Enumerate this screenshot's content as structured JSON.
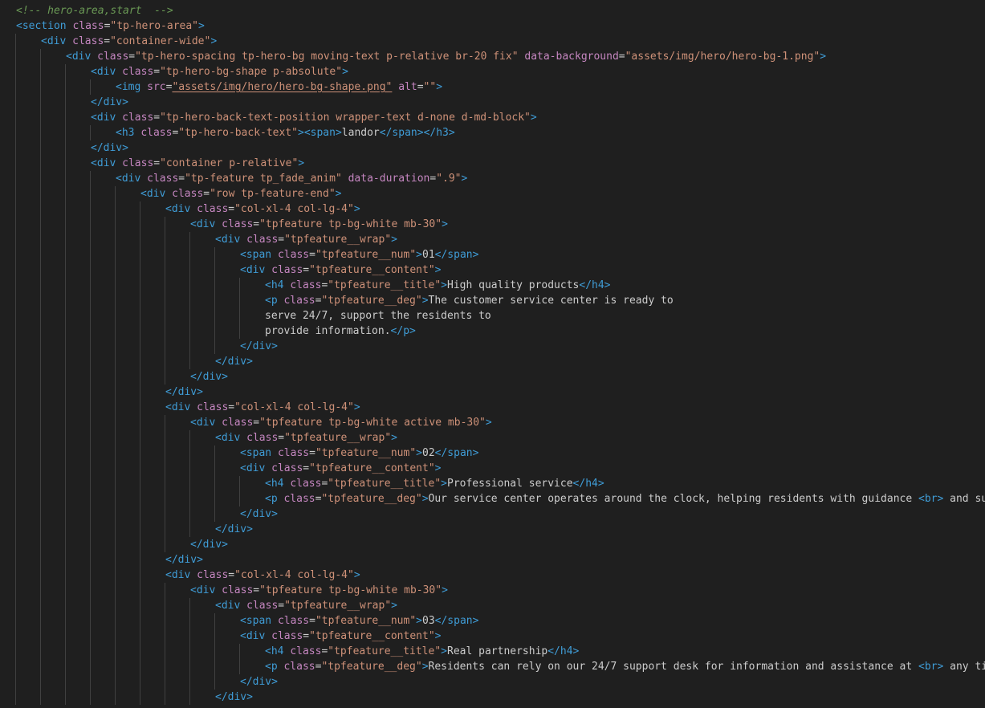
{
  "editor": {
    "language": "html",
    "lines": [
      {
        "indent": 0,
        "tokens": [
          [
            "c",
            "<!-- hero-area,start  -->"
          ]
        ]
      },
      {
        "indent": 0,
        "tokens": [
          [
            "t",
            "<section"
          ],
          [
            "x",
            " "
          ],
          [
            "a",
            "class"
          ],
          [
            "x",
            "="
          ],
          [
            "s",
            "\"tp-hero-area\""
          ],
          [
            "t",
            ">"
          ]
        ]
      },
      {
        "indent": 1,
        "tokens": [
          [
            "t",
            "<div"
          ],
          [
            "x",
            " "
          ],
          [
            "a",
            "class"
          ],
          [
            "x",
            "="
          ],
          [
            "s",
            "\"container-wide\""
          ],
          [
            "t",
            ">"
          ]
        ]
      },
      {
        "indent": 2,
        "tokens": [
          [
            "t",
            "<div"
          ],
          [
            "x",
            " "
          ],
          [
            "a",
            "class"
          ],
          [
            "x",
            "="
          ],
          [
            "s",
            "\"tp-hero-spacing tp-hero-bg moving-text p-relative br-20 fix\""
          ],
          [
            "x",
            " "
          ],
          [
            "a",
            "data-background"
          ],
          [
            "x",
            "="
          ],
          [
            "s",
            "\"assets/img/hero/hero-bg-1.png\""
          ],
          [
            "t",
            ">"
          ]
        ]
      },
      {
        "indent": 3,
        "tokens": [
          [
            "t",
            "<div"
          ],
          [
            "x",
            " "
          ],
          [
            "a",
            "class"
          ],
          [
            "x",
            "="
          ],
          [
            "s",
            "\"tp-hero-bg-shape p-absolute\""
          ],
          [
            "t",
            ">"
          ]
        ]
      },
      {
        "indent": 4,
        "tokens": [
          [
            "t",
            "<img"
          ],
          [
            "x",
            " "
          ],
          [
            "a",
            "src"
          ],
          [
            "x",
            "="
          ],
          [
            "su",
            "\"assets/img/hero/hero-bg-shape.png\""
          ],
          [
            "x",
            " "
          ],
          [
            "a",
            "alt"
          ],
          [
            "x",
            "="
          ],
          [
            "s",
            "\"\""
          ],
          [
            "t",
            ">"
          ]
        ]
      },
      {
        "indent": 3,
        "tokens": [
          [
            "t",
            "</div>"
          ]
        ]
      },
      {
        "indent": 3,
        "tokens": [
          [
            "t",
            "<div"
          ],
          [
            "x",
            " "
          ],
          [
            "a",
            "class"
          ],
          [
            "x",
            "="
          ],
          [
            "s",
            "\"tp-hero-back-text-position wrapper-text d-none d-md-block\""
          ],
          [
            "t",
            ">"
          ]
        ]
      },
      {
        "indent": 4,
        "tokens": [
          [
            "t",
            "<h3"
          ],
          [
            "x",
            " "
          ],
          [
            "a",
            "class"
          ],
          [
            "x",
            "="
          ],
          [
            "s",
            "\"tp-hero-back-text\""
          ],
          [
            "t",
            ">"
          ],
          [
            "t",
            "<span>"
          ],
          [
            "x",
            "landor"
          ],
          [
            "t",
            "</span>"
          ],
          [
            "t",
            "</h3>"
          ]
        ]
      },
      {
        "indent": 3,
        "tokens": [
          [
            "t",
            "</div>"
          ]
        ]
      },
      {
        "indent": 3,
        "tokens": [
          [
            "t",
            "<div"
          ],
          [
            "x",
            " "
          ],
          [
            "a",
            "class"
          ],
          [
            "x",
            "="
          ],
          [
            "s",
            "\"container p-relative\""
          ],
          [
            "t",
            ">"
          ]
        ]
      },
      {
        "indent": 4,
        "tokens": [
          [
            "t",
            "<div"
          ],
          [
            "x",
            " "
          ],
          [
            "a",
            "class"
          ],
          [
            "x",
            "="
          ],
          [
            "s",
            "\"tp-feature tp_fade_anim\""
          ],
          [
            "x",
            " "
          ],
          [
            "a",
            "data-duration"
          ],
          [
            "x",
            "="
          ],
          [
            "s",
            "\".9\""
          ],
          [
            "t",
            ">"
          ]
        ]
      },
      {
        "indent": 5,
        "tokens": [
          [
            "t",
            "<div"
          ],
          [
            "x",
            " "
          ],
          [
            "a",
            "class"
          ],
          [
            "x",
            "="
          ],
          [
            "s",
            "\"row tp-feature-end\""
          ],
          [
            "t",
            ">"
          ]
        ]
      },
      {
        "indent": 6,
        "tokens": [
          [
            "t",
            "<div"
          ],
          [
            "x",
            " "
          ],
          [
            "a",
            "class"
          ],
          [
            "x",
            "="
          ],
          [
            "s",
            "\"col-xl-4 col-lg-4\""
          ],
          [
            "t",
            ">"
          ]
        ]
      },
      {
        "indent": 7,
        "tokens": [
          [
            "t",
            "<div"
          ],
          [
            "x",
            " "
          ],
          [
            "a",
            "class"
          ],
          [
            "x",
            "="
          ],
          [
            "s",
            "\"tpfeature tp-bg-white mb-30\""
          ],
          [
            "t",
            ">"
          ]
        ]
      },
      {
        "indent": 8,
        "tokens": [
          [
            "t",
            "<div"
          ],
          [
            "x",
            " "
          ],
          [
            "a",
            "class"
          ],
          [
            "x",
            "="
          ],
          [
            "s",
            "\"tpfeature__wrap\""
          ],
          [
            "t",
            ">"
          ]
        ]
      },
      {
        "indent": 9,
        "tokens": [
          [
            "t",
            "<span"
          ],
          [
            "x",
            " "
          ],
          [
            "a",
            "class"
          ],
          [
            "x",
            "="
          ],
          [
            "s",
            "\"tpfeature__num\""
          ],
          [
            "t",
            ">"
          ],
          [
            "x",
            "01"
          ],
          [
            "t",
            "</span>"
          ]
        ]
      },
      {
        "indent": 9,
        "tokens": [
          [
            "t",
            "<div"
          ],
          [
            "x",
            " "
          ],
          [
            "a",
            "class"
          ],
          [
            "x",
            "="
          ],
          [
            "s",
            "\"tpfeature__content\""
          ],
          [
            "t",
            ">"
          ]
        ]
      },
      {
        "indent": 10,
        "tokens": [
          [
            "t",
            "<h4"
          ],
          [
            "x",
            " "
          ],
          [
            "a",
            "class"
          ],
          [
            "x",
            "="
          ],
          [
            "s",
            "\"tpfeature__title\""
          ],
          [
            "t",
            ">"
          ],
          [
            "x",
            "High quality products"
          ],
          [
            "t",
            "</h4>"
          ]
        ]
      },
      {
        "indent": 10,
        "tokens": [
          [
            "t",
            "<p"
          ],
          [
            "x",
            " "
          ],
          [
            "a",
            "class"
          ],
          [
            "x",
            "="
          ],
          [
            "s",
            "\"tpfeature__deg\""
          ],
          [
            "t",
            ">"
          ],
          [
            "x",
            "The customer service center is ready to"
          ]
        ]
      },
      {
        "indent": 10,
        "tokens": [
          [
            "x",
            "serve 24/7, support the residents to"
          ]
        ]
      },
      {
        "indent": 10,
        "tokens": [
          [
            "x",
            "provide information."
          ],
          [
            "t",
            "</p>"
          ]
        ]
      },
      {
        "indent": 9,
        "tokens": [
          [
            "t",
            "</div>"
          ]
        ]
      },
      {
        "indent": 8,
        "tokens": [
          [
            "t",
            "</div>"
          ]
        ]
      },
      {
        "indent": 7,
        "tokens": [
          [
            "t",
            "</div>"
          ]
        ]
      },
      {
        "indent": 6,
        "tokens": [
          [
            "t",
            "</div>"
          ]
        ]
      },
      {
        "indent": 6,
        "tokens": [
          [
            "t",
            "<div"
          ],
          [
            "x",
            " "
          ],
          [
            "a",
            "class"
          ],
          [
            "x",
            "="
          ],
          [
            "s",
            "\"col-xl-4 col-lg-4\""
          ],
          [
            "t",
            ">"
          ]
        ]
      },
      {
        "indent": 7,
        "tokens": [
          [
            "t",
            "<div"
          ],
          [
            "x",
            " "
          ],
          [
            "a",
            "class"
          ],
          [
            "x",
            "="
          ],
          [
            "s",
            "\"tpfeature tp-bg-white active mb-30\""
          ],
          [
            "t",
            ">"
          ]
        ]
      },
      {
        "indent": 8,
        "tokens": [
          [
            "t",
            "<div"
          ],
          [
            "x",
            " "
          ],
          [
            "a",
            "class"
          ],
          [
            "x",
            "="
          ],
          [
            "s",
            "\"tpfeature__wrap\""
          ],
          [
            "t",
            ">"
          ]
        ]
      },
      {
        "indent": 9,
        "tokens": [
          [
            "t",
            "<span"
          ],
          [
            "x",
            " "
          ],
          [
            "a",
            "class"
          ],
          [
            "x",
            "="
          ],
          [
            "s",
            "\"tpfeature__num\""
          ],
          [
            "t",
            ">"
          ],
          [
            "x",
            "02"
          ],
          [
            "t",
            "</span>"
          ]
        ]
      },
      {
        "indent": 9,
        "tokens": [
          [
            "t",
            "<div"
          ],
          [
            "x",
            " "
          ],
          [
            "a",
            "class"
          ],
          [
            "x",
            "="
          ],
          [
            "s",
            "\"tpfeature__content\""
          ],
          [
            "t",
            ">"
          ]
        ]
      },
      {
        "indent": 10,
        "tokens": [
          [
            "t",
            "<h4"
          ],
          [
            "x",
            " "
          ],
          [
            "a",
            "class"
          ],
          [
            "x",
            "="
          ],
          [
            "s",
            "\"tpfeature__title\""
          ],
          [
            "t",
            ">"
          ],
          [
            "x",
            "Professional service"
          ],
          [
            "t",
            "</h4>"
          ]
        ]
      },
      {
        "indent": 10,
        "tokens": [
          [
            "t",
            "<p"
          ],
          [
            "x",
            " "
          ],
          [
            "a",
            "class"
          ],
          [
            "x",
            "="
          ],
          [
            "s",
            "\"tpfeature__deg\""
          ],
          [
            "t",
            ">"
          ],
          [
            "x",
            "Our service center operates around the clock, helping residents with guidance "
          ],
          [
            "t",
            "<br>"
          ],
          [
            "x",
            " and supp"
          ]
        ]
      },
      {
        "indent": 9,
        "tokens": [
          [
            "t",
            "</div>"
          ]
        ]
      },
      {
        "indent": 8,
        "tokens": [
          [
            "t",
            "</div>"
          ]
        ]
      },
      {
        "indent": 7,
        "tokens": [
          [
            "t",
            "</div>"
          ]
        ]
      },
      {
        "indent": 6,
        "tokens": [
          [
            "t",
            "</div>"
          ]
        ]
      },
      {
        "indent": 6,
        "tokens": [
          [
            "t",
            "<div"
          ],
          [
            "x",
            " "
          ],
          [
            "a",
            "class"
          ],
          [
            "x",
            "="
          ],
          [
            "s",
            "\"col-xl-4 col-lg-4\""
          ],
          [
            "t",
            ">"
          ]
        ]
      },
      {
        "indent": 7,
        "tokens": [
          [
            "t",
            "<div"
          ],
          [
            "x",
            " "
          ],
          [
            "a",
            "class"
          ],
          [
            "x",
            "="
          ],
          [
            "s",
            "\"tpfeature tp-bg-white mb-30\""
          ],
          [
            "t",
            ">"
          ]
        ]
      },
      {
        "indent": 8,
        "tokens": [
          [
            "t",
            "<div"
          ],
          [
            "x",
            " "
          ],
          [
            "a",
            "class"
          ],
          [
            "x",
            "="
          ],
          [
            "s",
            "\"tpfeature__wrap\""
          ],
          [
            "t",
            ">"
          ]
        ]
      },
      {
        "indent": 9,
        "tokens": [
          [
            "t",
            "<span"
          ],
          [
            "x",
            " "
          ],
          [
            "a",
            "class"
          ],
          [
            "x",
            "="
          ],
          [
            "s",
            "\"tpfeature__num\""
          ],
          [
            "t",
            ">"
          ],
          [
            "x",
            "03"
          ],
          [
            "t",
            "</span>"
          ]
        ]
      },
      {
        "indent": 9,
        "tokens": [
          [
            "t",
            "<div"
          ],
          [
            "x",
            " "
          ],
          [
            "a",
            "class"
          ],
          [
            "x",
            "="
          ],
          [
            "s",
            "\"tpfeature__content\""
          ],
          [
            "t",
            ">"
          ]
        ]
      },
      {
        "indent": 10,
        "tokens": [
          [
            "t",
            "<h4"
          ],
          [
            "x",
            " "
          ],
          [
            "a",
            "class"
          ],
          [
            "x",
            "="
          ],
          [
            "s",
            "\"tpfeature__title\""
          ],
          [
            "t",
            ">"
          ],
          [
            "x",
            "Real partnership"
          ],
          [
            "t",
            "</h4>"
          ]
        ]
      },
      {
        "indent": 10,
        "tokens": [
          [
            "t",
            "<p"
          ],
          [
            "x",
            " "
          ],
          [
            "a",
            "class"
          ],
          [
            "x",
            "="
          ],
          [
            "s",
            "\"tpfeature__deg\""
          ],
          [
            "t",
            ">"
          ],
          [
            "x",
            "Residents can rely on our 24/7 support desk for information and assistance at "
          ],
          [
            "t",
            "<br>"
          ],
          [
            "x",
            " any time"
          ]
        ]
      },
      {
        "indent": 9,
        "tokens": [
          [
            "t",
            "</div>"
          ]
        ]
      },
      {
        "indent": 8,
        "tokens": [
          [
            "t",
            "</div>"
          ]
        ]
      }
    ]
  }
}
